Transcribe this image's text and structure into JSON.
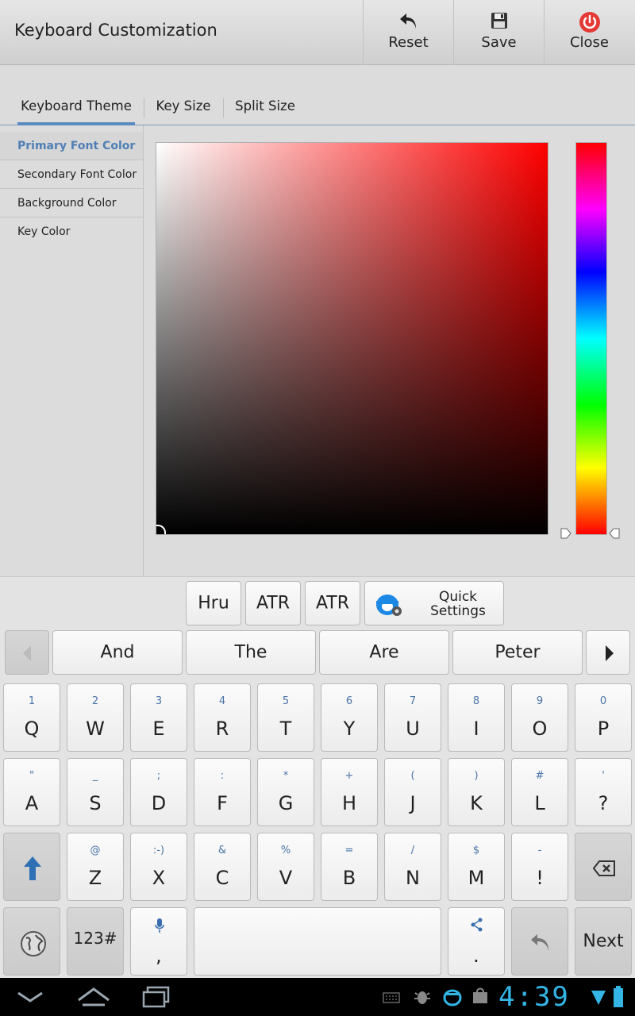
{
  "app": {
    "title": "Keyboard Customization"
  },
  "actions": {
    "reset": "Reset",
    "save": "Save",
    "close": "Close"
  },
  "tabs": [
    "Keyboard Theme",
    "Key Size",
    "Split Size"
  ],
  "list": [
    "Primary Font Color",
    "Secondary Font Color",
    "Background Color",
    "Key Color"
  ],
  "picker": {
    "hue_color": "#ff0000"
  },
  "toolbar": {
    "hru": "Hru",
    "atr1": "ATR",
    "atr2": "ATR",
    "quick": "Quick",
    "settings": "Settings"
  },
  "suggestions": [
    "And",
    "The",
    "Are",
    "Peter"
  ],
  "row1": {
    "keys": [
      "Q",
      "W",
      "E",
      "R",
      "T",
      "Y",
      "U",
      "I",
      "O",
      "P"
    ],
    "alts": [
      "1",
      "2",
      "3",
      "4",
      "5",
      "6",
      "7",
      "8",
      "9",
      "0"
    ]
  },
  "row2": {
    "keys": [
      "A",
      "S",
      "D",
      "F",
      "G",
      "H",
      "J",
      "K",
      "L",
      "?"
    ],
    "alts": [
      "\"",
      "_",
      ";",
      ":",
      "*",
      "+",
      "(",
      ")",
      "#",
      "'"
    ]
  },
  "row3": {
    "keys": [
      "Z",
      "X",
      "C",
      "V",
      "B",
      "N",
      "M",
      "!"
    ],
    "alts": [
      "@",
      ":-)",
      "&",
      "%",
      "=",
      "/",
      "$",
      "-"
    ]
  },
  "row4": {
    "num": "123#",
    "comma": ",",
    "period": ".",
    "next": "Next"
  },
  "status": {
    "time": "4:39"
  }
}
